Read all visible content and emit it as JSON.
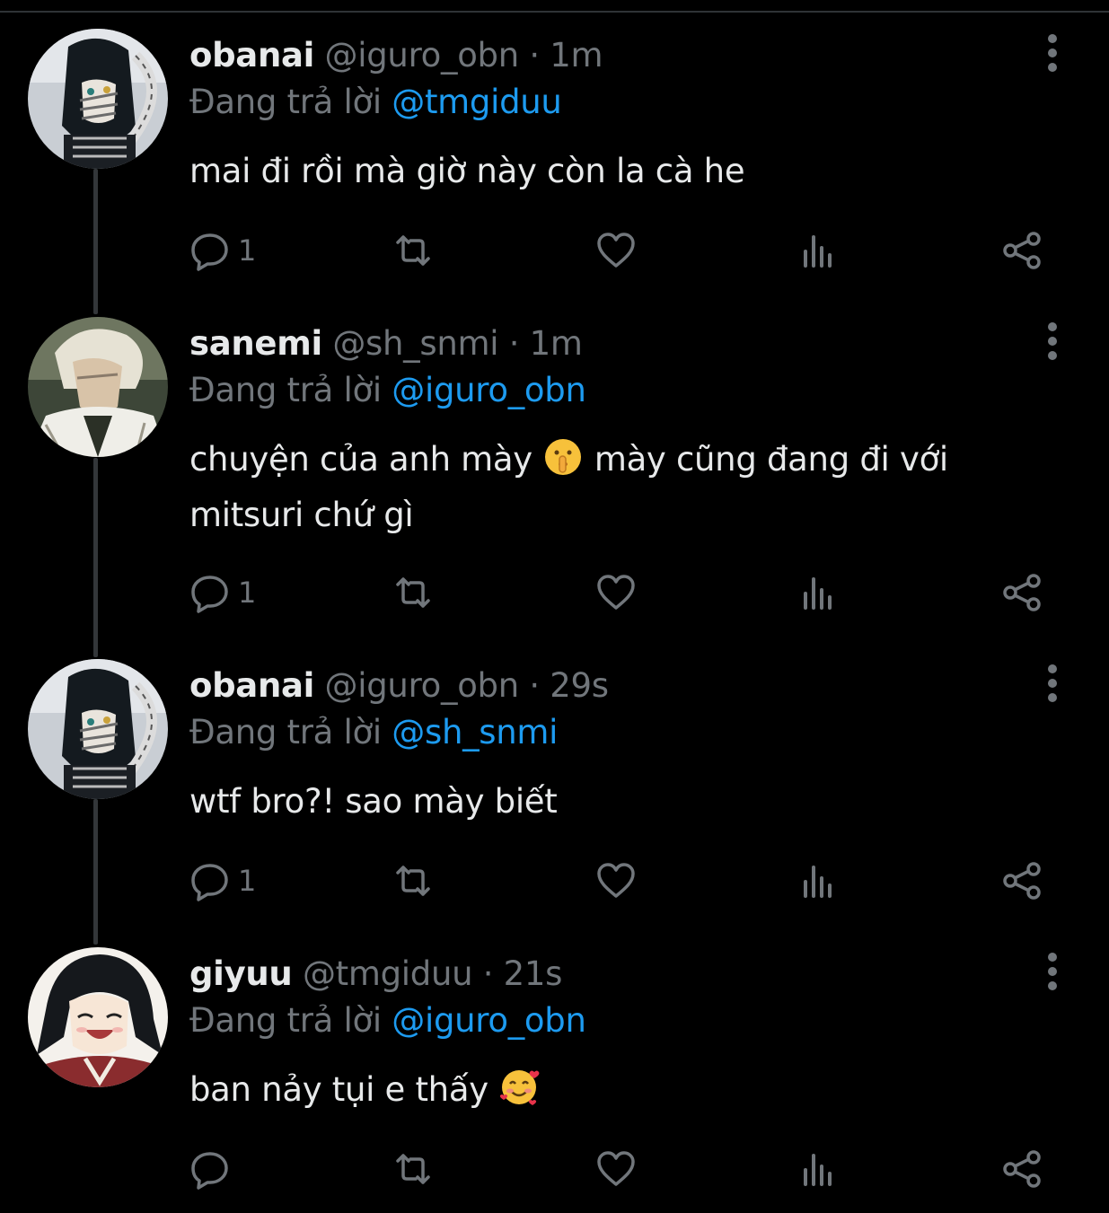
{
  "colors": {
    "background": "#000000",
    "text_primary": "#e7e9ea",
    "text_secondary": "#71767b",
    "accent": "#1d9bf0",
    "thread_line": "#333639"
  },
  "reply_prefix": "Đang trả lời",
  "tweets": [
    {
      "avatar": "obanai-avatar",
      "display_name": "obanai",
      "handle": "@iguro_obn",
      "time": "1m",
      "reply_to": "@tmgiduu",
      "text_parts": [
        "mai đi rồi mà giờ này còn la cà he"
      ],
      "reply_count": "1"
    },
    {
      "avatar": "sanemi-avatar",
      "display_name": "sanemi",
      "handle": "@sh_snmi",
      "time": "1m",
      "reply_to": "@iguro_obn",
      "text_parts": [
        "chuyện của anh mày ",
        " mày cũng đang đi với mitsuri chứ gì"
      ],
      "emoji": "shushing-face-emoji",
      "reply_count": "1"
    },
    {
      "avatar": "obanai-avatar",
      "display_name": "obanai",
      "handle": "@iguro_obn",
      "time": "29s",
      "reply_to": "@sh_snmi",
      "text_parts": [
        "wtf bro?! sao mày biết"
      ],
      "reply_count": "1"
    },
    {
      "avatar": "giyuu-avatar",
      "display_name": "giyuu",
      "handle": "@tmgiduu",
      "time": "21s",
      "reply_to": "@iguro_obn",
      "text_parts": [
        "ban nảy tụi e thấy "
      ],
      "emoji": "smiling-face-with-hearts-emoji",
      "reply_count": ""
    }
  ],
  "icons": [
    "reply-icon",
    "retweet-icon",
    "like-icon",
    "views-icon",
    "share-icon",
    "more-icon"
  ]
}
